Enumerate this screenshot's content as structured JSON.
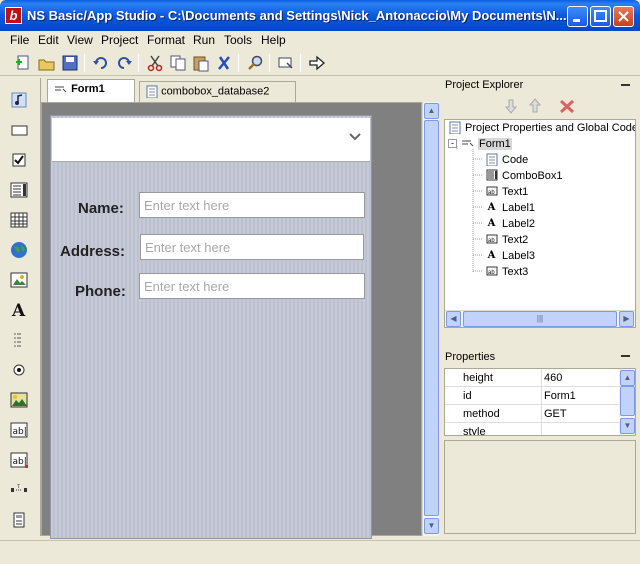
{
  "window": {
    "title": "NS Basic/App Studio - C:\\Documents and Settings\\Nick_Antonaccio\\My Documents\\N..."
  },
  "menu": [
    "File",
    "Edit",
    "View",
    "Project",
    "Format",
    "Run",
    "Tools",
    "Help"
  ],
  "toolbar": {
    "icons": [
      "new-icon",
      "open-icon",
      "save-icon",
      "undo-icon",
      "redo-icon",
      "cut-icon",
      "copy-icon",
      "paste-icon",
      "delete-icon",
      "find-icon",
      "deploy-icon",
      "run-icon"
    ]
  },
  "tabs": [
    {
      "label": "Form1",
      "active": true
    },
    {
      "label": "combobox_database2",
      "active": false
    }
  ],
  "form": {
    "fields": [
      {
        "label": "Name:",
        "placeholder": "Enter text here"
      },
      {
        "label": "Address:",
        "placeholder": "Enter text here"
      },
      {
        "label": "Phone:",
        "placeholder": "Enter text here"
      }
    ]
  },
  "project_explorer": {
    "title": "Project Explorer",
    "root": "Project Properties and Global Code",
    "form": "Form1",
    "items": [
      "Code",
      "ComboBox1",
      "Text1",
      "Label1",
      "Label2",
      "Text2",
      "Label3",
      "Text3"
    ]
  },
  "properties": {
    "title": "Properties",
    "rows": [
      {
        "name": "height",
        "value": "460"
      },
      {
        "name": "id",
        "value": "Form1"
      },
      {
        "name": "method",
        "value": "GET"
      },
      {
        "name": "style",
        "value": ""
      }
    ]
  },
  "colors": {
    "titlebar": "#0a5adb",
    "close": "#c8401c",
    "accent_red": "#d03030"
  }
}
